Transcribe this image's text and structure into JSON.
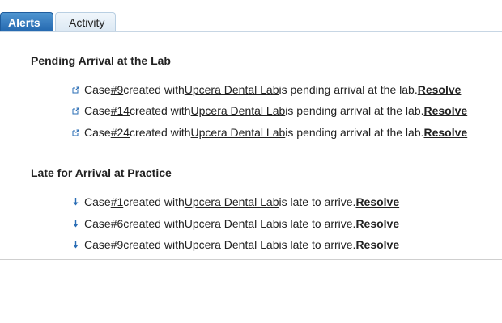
{
  "tabs": [
    {
      "label": "Alerts",
      "active": true
    },
    {
      "label": "Activity",
      "active": false
    }
  ],
  "sections": {
    "pending": {
      "title": "Pending Arrival at the Lab",
      "icon": "external-link-icon",
      "rows": [
        {
          "prefix": "Case ",
          "case": "#9",
          "mid": " created with ",
          "lab": "Upcera Dental Lab",
          "suffix": " is pending arrival at the lab. ",
          "action": "Resolve"
        },
        {
          "prefix": "Case ",
          "case": "#14",
          "mid": " created with ",
          "lab": "Upcera Dental Lab",
          "suffix": " is pending arrival at the lab. ",
          "action": "Resolve"
        },
        {
          "prefix": "Case ",
          "case": "#24",
          "mid": " created with ",
          "lab": "Upcera Dental Lab",
          "suffix": " is pending arrival at the lab. ",
          "action": "Resolve"
        }
      ]
    },
    "late": {
      "title": "Late for Arrival at Practice",
      "icon": "down-arrow-icon",
      "rows": [
        {
          "prefix": "Case ",
          "case": "#1",
          "mid": " created with ",
          "lab": "Upcera Dental Lab",
          "suffix": " is late to arrive. ",
          "action": "Resolve"
        },
        {
          "prefix": "Case ",
          "case": "#6",
          "mid": " created with ",
          "lab": "Upcera Dental Lab",
          "suffix": " is late to arrive. ",
          "action": "Resolve"
        },
        {
          "prefix": "Case ",
          "case": "#9",
          "mid": " created with ",
          "lab": "Upcera Dental Lab",
          "suffix": " is late to arrive. ",
          "action": "Resolve"
        }
      ]
    }
  },
  "colors": {
    "tab_active": "#2266ae",
    "tab_inactive": "#dbe8f3",
    "icon": "#2a6db5"
  }
}
